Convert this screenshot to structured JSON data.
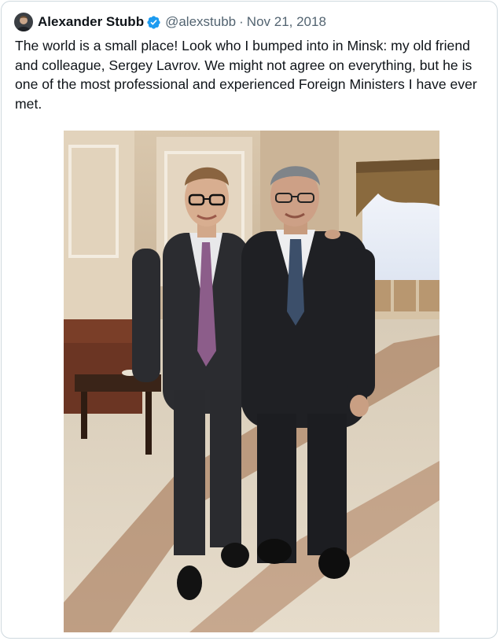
{
  "tweet": {
    "author_name": "Alexander Stubb",
    "handle": "@alexstubb",
    "separator": "·",
    "date": "Nov 21, 2018",
    "text": "The world is a small place! Look who I bumped into in Minsk: my old friend and colleague, Sergey Lavrov. We might not agree on everything, but he is one of the most professional and experienced Foreign Ministers I have ever met.",
    "verified": true
  },
  "icons": {
    "verified": "verified-badge-icon"
  },
  "colors": {
    "verified_blue": "#1d9bf0",
    "secondary_text": "#536471",
    "border": "#cfd9de"
  }
}
